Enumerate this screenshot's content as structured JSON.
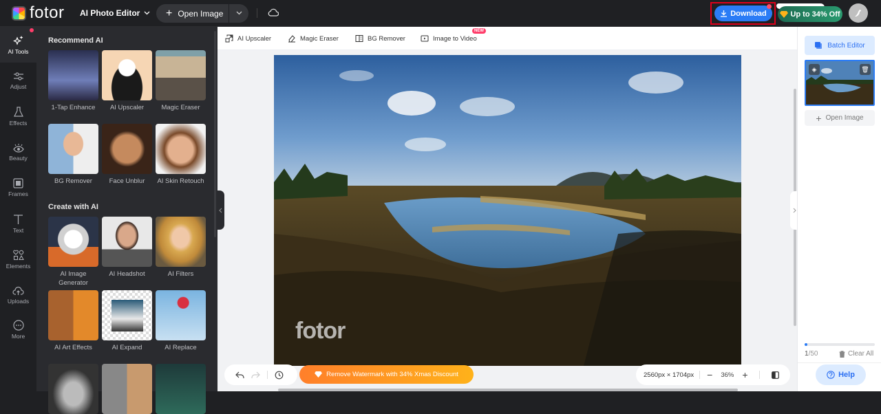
{
  "header": {
    "brand": "fotor",
    "product_menu": "AI Photo Editor",
    "open_image": "Open Image",
    "download": "Download",
    "promo": "Up to 34% Off",
    "icons": {
      "cloud": "cloud-icon",
      "avatar": "bird-avatar-icon"
    }
  },
  "rail": {
    "items": [
      {
        "label": "AI Tools",
        "icon": "sparkle-icon",
        "active": true
      },
      {
        "label": "Adjust",
        "icon": "sliders-icon"
      },
      {
        "label": "Effects",
        "icon": "flask-icon"
      },
      {
        "label": "Beauty",
        "icon": "eye-icon"
      },
      {
        "label": "Frames",
        "icon": "frame-icon"
      },
      {
        "label": "Text",
        "icon": "text-icon"
      },
      {
        "label": "Elements",
        "icon": "shapes-icon"
      },
      {
        "label": "Uploads",
        "icon": "cloud-upload-icon"
      },
      {
        "label": "More",
        "icon": "more-icon"
      }
    ]
  },
  "panel": {
    "recommend_title": "Recommend AI",
    "recommend": [
      {
        "label": "1-Tap Enhance"
      },
      {
        "label": "AI Upscaler"
      },
      {
        "label": "Magic Eraser"
      },
      {
        "label": "BG Remover"
      },
      {
        "label": "Face Unblur"
      },
      {
        "label": "AI Skin Retouch"
      }
    ],
    "create_title": "Create with AI",
    "create": [
      {
        "label": "AI Image Generator"
      },
      {
        "label": "AI Headshot"
      },
      {
        "label": "AI Filters"
      },
      {
        "label": "AI Art Effects"
      },
      {
        "label": "AI Expand"
      },
      {
        "label": "AI Replace"
      }
    ]
  },
  "toolstrip": {
    "tools": [
      {
        "label": "AI Upscaler",
        "icon": "upscale-icon"
      },
      {
        "label": "Magic Eraser",
        "icon": "eraser-icon"
      },
      {
        "label": "BG Remover",
        "icon": "bg-remove-icon"
      },
      {
        "label": "Image to Video",
        "icon": "video-icon"
      }
    ],
    "new_badge": "NEW"
  },
  "canvas": {
    "watermark": "fotor",
    "remove_watermark": "Remove Watermark with 34% Xmas Discount",
    "dimensions": "2560px × 1704px",
    "zoom": "36%"
  },
  "right_panel": {
    "batch_editor": "Batch Editor",
    "open_image": "Open Image",
    "count_current": "1",
    "count_total": "/50",
    "progress_fraction": 0.02,
    "clear_all": "Clear All",
    "help": "Help"
  }
}
